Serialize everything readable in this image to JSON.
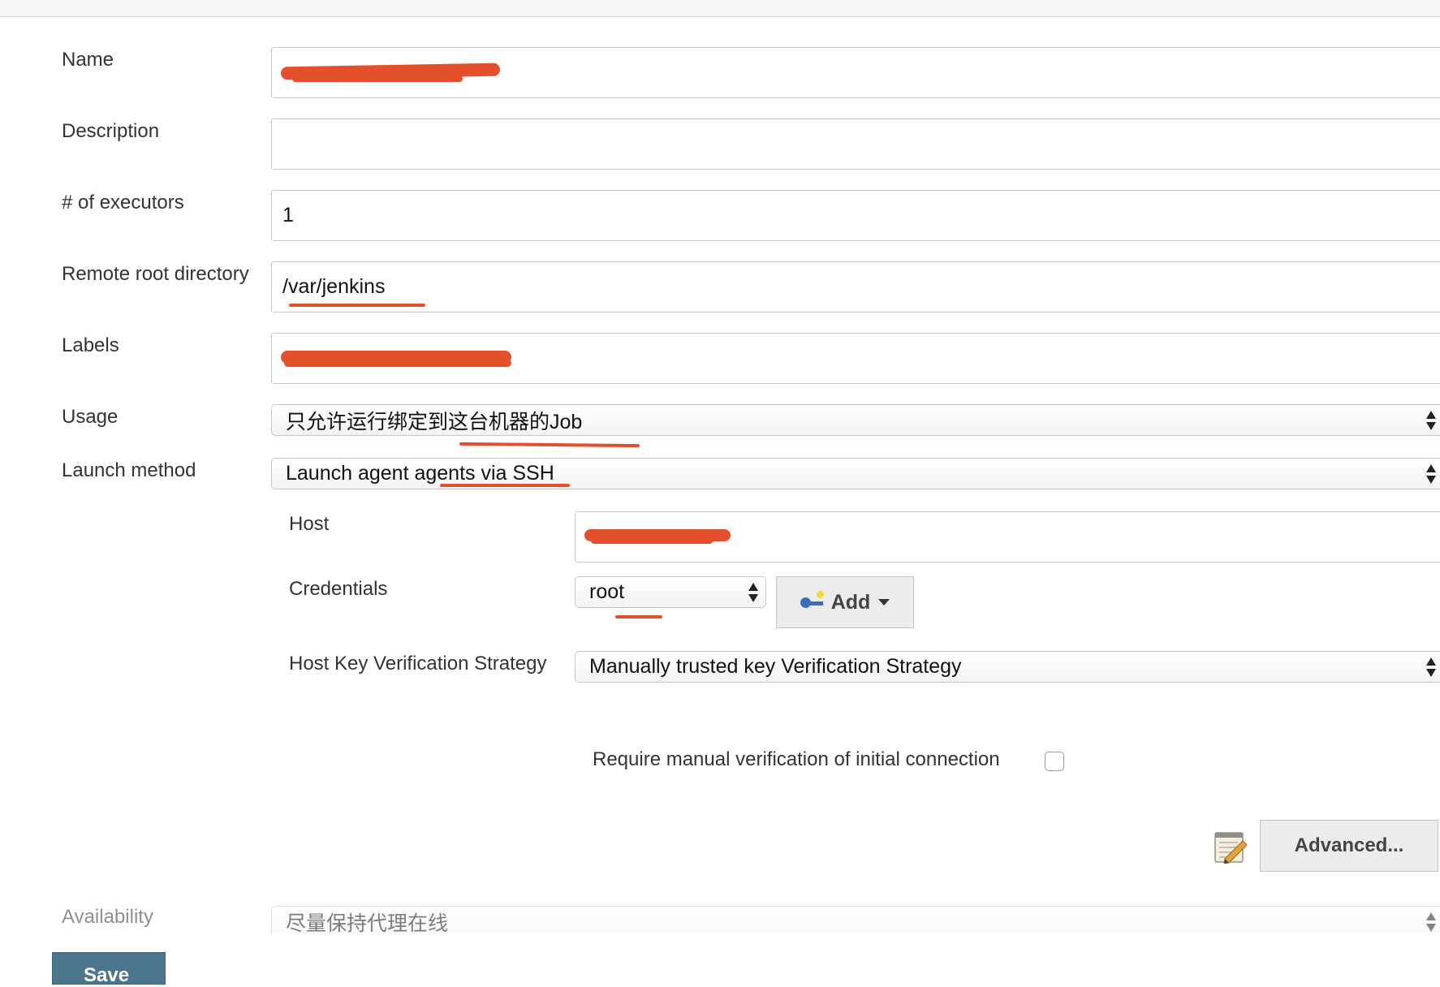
{
  "form": {
    "name": {
      "label": "Name",
      "value": ""
    },
    "description": {
      "label": "Description",
      "value": ""
    },
    "executors": {
      "label": "# of executors",
      "value": "1"
    },
    "remote_root": {
      "label": "Remote root directory",
      "value": "/var/jenkins"
    },
    "labels": {
      "label": "Labels",
      "value": ""
    },
    "usage": {
      "label": "Usage",
      "value": "只允许运行绑定到这台机器的Job"
    },
    "launch_method": {
      "label": "Launch method",
      "value": "Launch agent agents via SSH"
    },
    "host": {
      "label": "Host",
      "value": ""
    },
    "credentials": {
      "label": "Credentials",
      "value": "root",
      "add_label": "Add"
    },
    "host_key": {
      "label": "Host Key Verification Strategy",
      "value": "Manually trusted key Verification Strategy"
    },
    "manual_verification": {
      "label": "Require manual verification of initial connection",
      "checked": false
    },
    "advanced_label": "Advanced...",
    "availability": {
      "label": "Availability",
      "value": "尽量保持代理在线"
    }
  },
  "save_label": "Save",
  "annotation_color": "#e5502c"
}
